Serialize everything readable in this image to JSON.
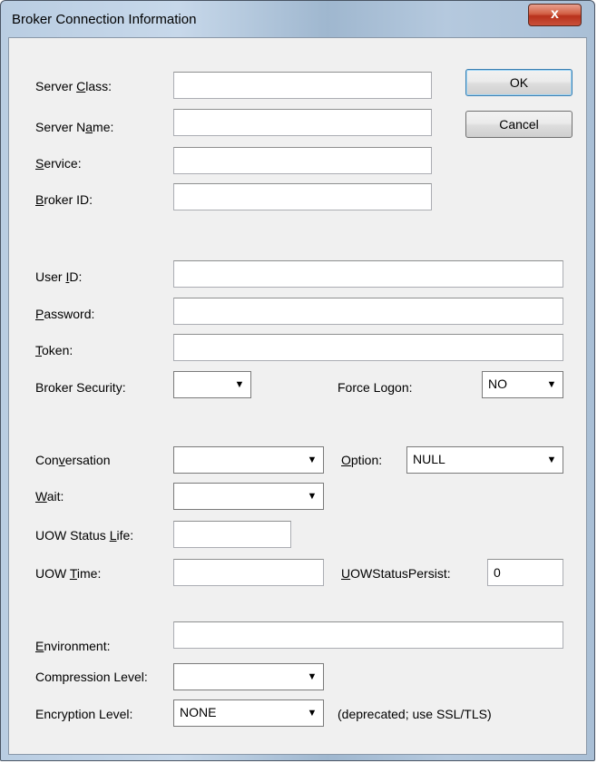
{
  "window": {
    "title": "Broker Connection Information",
    "close_glyph": "x"
  },
  "buttons": {
    "ok": "OK",
    "cancel": "Cancel"
  },
  "labels": {
    "server_class": {
      "pre": "Server ",
      "key": "C",
      "post": "lass:"
    },
    "server_name": {
      "pre": "Server N",
      "key": "a",
      "post": "me:"
    },
    "service": {
      "pre": "",
      "key": "S",
      "post": "ervice:"
    },
    "broker_id": {
      "pre": "",
      "key": "B",
      "post": "roker ID:"
    },
    "user_id": {
      "pre": "User ",
      "key": "I",
      "post": "D:"
    },
    "password": {
      "pre": "",
      "key": "P",
      "post": "assword:"
    },
    "token": {
      "pre": "",
      "key": "T",
      "post": "oken:"
    },
    "broker_security": "Broker Security:",
    "force_logon": "Force Logon:",
    "conversation": {
      "pre": "Con",
      "key": "v",
      "post": "ersation"
    },
    "option": {
      "pre": "",
      "key": "O",
      "post": "ption:"
    },
    "wait": {
      "pre": "",
      "key": "W",
      "post": "ait:"
    },
    "uow_status_life": {
      "pre": "UOW Status ",
      "key": "L",
      "post": "ife:"
    },
    "uow_time": {
      "pre": "UOW ",
      "key": "T",
      "post": "ime:"
    },
    "uow_status_persist": {
      "pre": "",
      "key": "U",
      "post": "OWStatusPersist:"
    },
    "environment": {
      "pre": "",
      "key": "E",
      "post": "nvironment:"
    },
    "compression_level": "Compression Level:",
    "encryption_level": "Encryption Level:",
    "deprecated_note": "(deprecated; use SSL/TLS)"
  },
  "fields": {
    "server_class": "",
    "server_name": "",
    "service": "",
    "broker_id": "",
    "user_id": "",
    "password": "",
    "token": "",
    "uow_status_life": "",
    "uow_time": "",
    "uow_status_persist": "0",
    "environment": ""
  },
  "selects": {
    "broker_security": "",
    "force_logon": "NO",
    "conversation": "",
    "option": "NULL",
    "wait": "",
    "compression_level": "",
    "encryption_level": "NONE"
  },
  "icons": {
    "dropdown_arrow": "▼"
  }
}
